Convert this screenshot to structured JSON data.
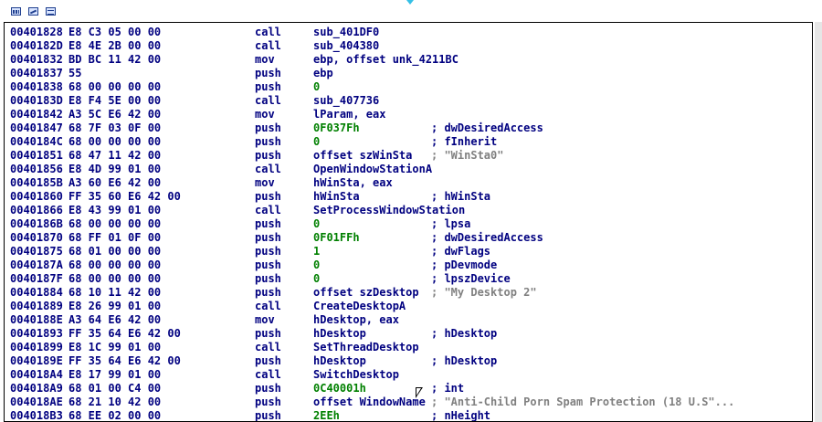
{
  "toolbar": {
    "icons": [
      "graph-view-icon",
      "proximity-view-icon",
      "text-view-icon"
    ]
  },
  "colors": {
    "text": "#000080",
    "number": "#008000",
    "string_comment": "#808080",
    "border": "#000000"
  },
  "disasm": {
    "lines": [
      {
        "addr": "00401828",
        "bytes": "E8 C3 05 00 00",
        "mnemonic": "call",
        "operand": "sub_401DF0",
        "comment": ""
      },
      {
        "addr": "0040182D",
        "bytes": "E8 4E 2B 00 00",
        "mnemonic": "call",
        "operand": "sub_404380",
        "comment": ""
      },
      {
        "addr": "00401832",
        "bytes": "BD BC 11 42 00",
        "mnemonic": "mov",
        "operand": "ebp, offset unk_4211BC",
        "comment": ""
      },
      {
        "addr": "00401837",
        "bytes": "55",
        "mnemonic": "push",
        "operand": "ebp",
        "comment": ""
      },
      {
        "addr": "00401838",
        "bytes": "68 00 00 00 00",
        "mnemonic": "push",
        "operand": "0",
        "comment": ""
      },
      {
        "addr": "0040183D",
        "bytes": "E8 F4 5E 00 00",
        "mnemonic": "call",
        "operand": "sub_407736",
        "comment": ""
      },
      {
        "addr": "00401842",
        "bytes": "A3 5C E6 42 00",
        "mnemonic": "mov",
        "operand": "lParam, eax",
        "comment": ""
      },
      {
        "addr": "00401847",
        "bytes": "68 7F 03 0F 00",
        "mnemonic": "push",
        "operand": "0F037Fh",
        "comment": "; dwDesiredAccess"
      },
      {
        "addr": "0040184C",
        "bytes": "68 00 00 00 00",
        "mnemonic": "push",
        "operand": "0",
        "comment": "; fInherit"
      },
      {
        "addr": "00401851",
        "bytes": "68 47 11 42 00",
        "mnemonic": "push",
        "operand": "offset szWinSta",
        "comment": "; \"WinSta0\""
      },
      {
        "addr": "00401856",
        "bytes": "E8 4D 99 01 00",
        "mnemonic": "call",
        "operand": "OpenWindowStationA",
        "comment": ""
      },
      {
        "addr": "0040185B",
        "bytes": "A3 60 E6 42 00",
        "mnemonic": "mov",
        "operand": "hWinSta, eax",
        "comment": ""
      },
      {
        "addr": "00401860",
        "bytes": "FF 35 60 E6 42 00",
        "mnemonic": "push",
        "operand": "hWinSta",
        "comment": "; hWinSta"
      },
      {
        "addr": "00401866",
        "bytes": "E8 43 99 01 00",
        "mnemonic": "call",
        "operand": "SetProcessWindowStation",
        "comment": ""
      },
      {
        "addr": "0040186B",
        "bytes": "68 00 00 00 00",
        "mnemonic": "push",
        "operand": "0",
        "comment": "; lpsa"
      },
      {
        "addr": "00401870",
        "bytes": "68 FF 01 0F 00",
        "mnemonic": "push",
        "operand": "0F01FFh",
        "comment": "; dwDesiredAccess"
      },
      {
        "addr": "00401875",
        "bytes": "68 01 00 00 00",
        "mnemonic": "push",
        "operand": "1",
        "comment": "; dwFlags"
      },
      {
        "addr": "0040187A",
        "bytes": "68 00 00 00 00",
        "mnemonic": "push",
        "operand": "0",
        "comment": "; pDevmode"
      },
      {
        "addr": "0040187F",
        "bytes": "68 00 00 00 00",
        "mnemonic": "push",
        "operand": "0",
        "comment": "; lpszDevice"
      },
      {
        "addr": "00401884",
        "bytes": "68 10 11 42 00",
        "mnemonic": "push",
        "operand": "offset szDesktop",
        "comment": "; \"My Desktop 2\""
      },
      {
        "addr": "00401889",
        "bytes": "E8 26 99 01 00",
        "mnemonic": "call",
        "operand": "CreateDesktopA",
        "comment": ""
      },
      {
        "addr": "0040188E",
        "bytes": "A3 64 E6 42 00",
        "mnemonic": "mov",
        "operand": "hDesktop, eax",
        "comment": ""
      },
      {
        "addr": "00401893",
        "bytes": "FF 35 64 E6 42 00",
        "mnemonic": "push",
        "operand": "hDesktop",
        "comment": "; hDesktop"
      },
      {
        "addr": "00401899",
        "bytes": "E8 1C 99 01 00",
        "mnemonic": "call",
        "operand": "SetThreadDesktop",
        "comment": ""
      },
      {
        "addr": "0040189E",
        "bytes": "FF 35 64 E6 42 00",
        "mnemonic": "push",
        "operand": "hDesktop",
        "comment": "; hDesktop"
      },
      {
        "addr": "004018A4",
        "bytes": "E8 17 99 01 00",
        "mnemonic": "call",
        "operand": "SwitchDesktop",
        "comment": ""
      },
      {
        "addr": "004018A9",
        "bytes": "68 01 00 C4 00",
        "mnemonic": "push",
        "operand": "0C40001h",
        "comment": "; int"
      },
      {
        "addr": "004018AE",
        "bytes": "68 21 10 42 00",
        "mnemonic": "push",
        "operand": "offset WindowName",
        "comment": "; \"Anti-Child Porn Spam Protection (18 U.S\"..."
      },
      {
        "addr": "004018B3",
        "bytes": "68 EE 02 00 00",
        "mnemonic": "push",
        "operand": "2EEh",
        "comment": "; nHeight"
      }
    ]
  }
}
